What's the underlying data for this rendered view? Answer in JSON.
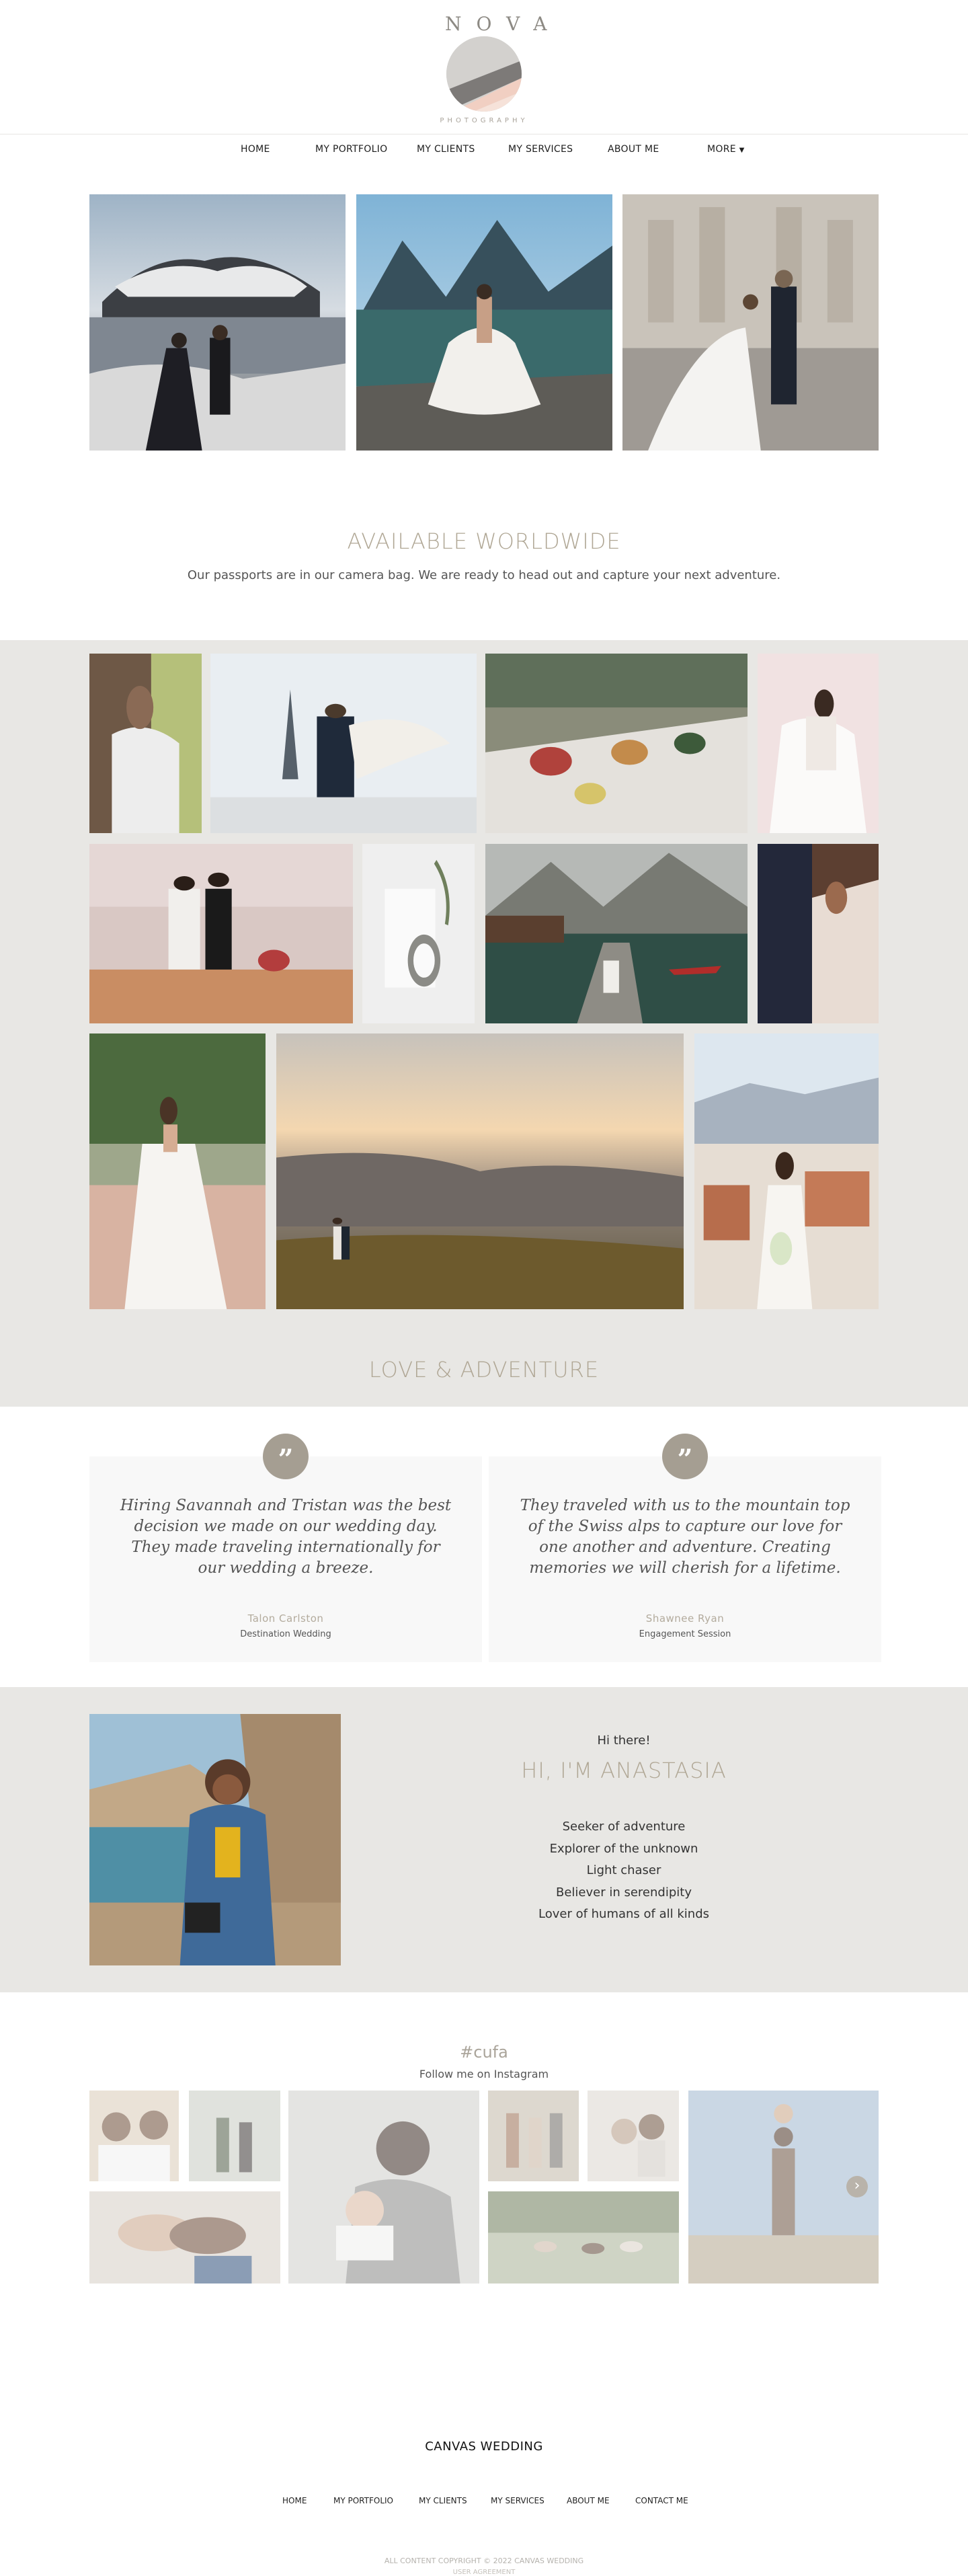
{
  "logo": {
    "word": "NOVA",
    "sub": "PHOTOGRAPHY"
  },
  "nav": {
    "items": [
      "HOME",
      "MY PORTFOLIO",
      "MY CLIENTS",
      "MY SERVICES",
      "ABOUT ME",
      "MORE"
    ],
    "more_icon": "chevron-down-icon"
  },
  "worldwide": {
    "title": "AVAILABLE WORLDWIDE",
    "subtitle": "Our passports are in our camera bag.  We are ready to head out and capture your next adventure."
  },
  "gallery": {
    "title": "LOVE & ADVENTURE"
  },
  "testimonials": [
    {
      "quote": "Hiring Savannah and Tristan was the best decision we made on our wedding day. They made traveling internationally for our wedding a breeze.",
      "name": "Talon Carlston",
      "type": "Destination Wedding",
      "icon": "quote-icon"
    },
    {
      "quote": "They traveled with us to the mountain top of the Swiss alps to capture our love for one another and adventure. Creating memories we will cherish for a lifetime.",
      "name": "Shawnee Ryan",
      "type": "Engagement Session",
      "icon": "quote-icon"
    }
  ],
  "about": {
    "greeting": "Hi there!",
    "name": "HI, I'M ANASTASIA",
    "lines": [
      "Seeker of adventure",
      "Explorer of the unknown",
      "Light chaser",
      "Believer in serendipity",
      "Lover of humans of all kinds"
    ]
  },
  "instagram": {
    "tag": "#cufa",
    "follow": "Follow me on Instagram",
    "arrow_icon": "chevron-right-icon"
  },
  "footer": {
    "brand": "CANVAS WEDDING",
    "nav": [
      "HOME",
      "MY PORTFOLIO",
      "MY CLIENTS",
      "MY SERVICES",
      "ABOUT ME",
      "CONTACT ME"
    ],
    "copyright": "ALL CONTENT COPYRIGHT © 2022 CANVAS WEDDING",
    "legal": "USER AGREEMENT"
  },
  "colors": {
    "accent": "#b0a795",
    "band": "#e8e7e4",
    "badge": "#a59e92"
  }
}
